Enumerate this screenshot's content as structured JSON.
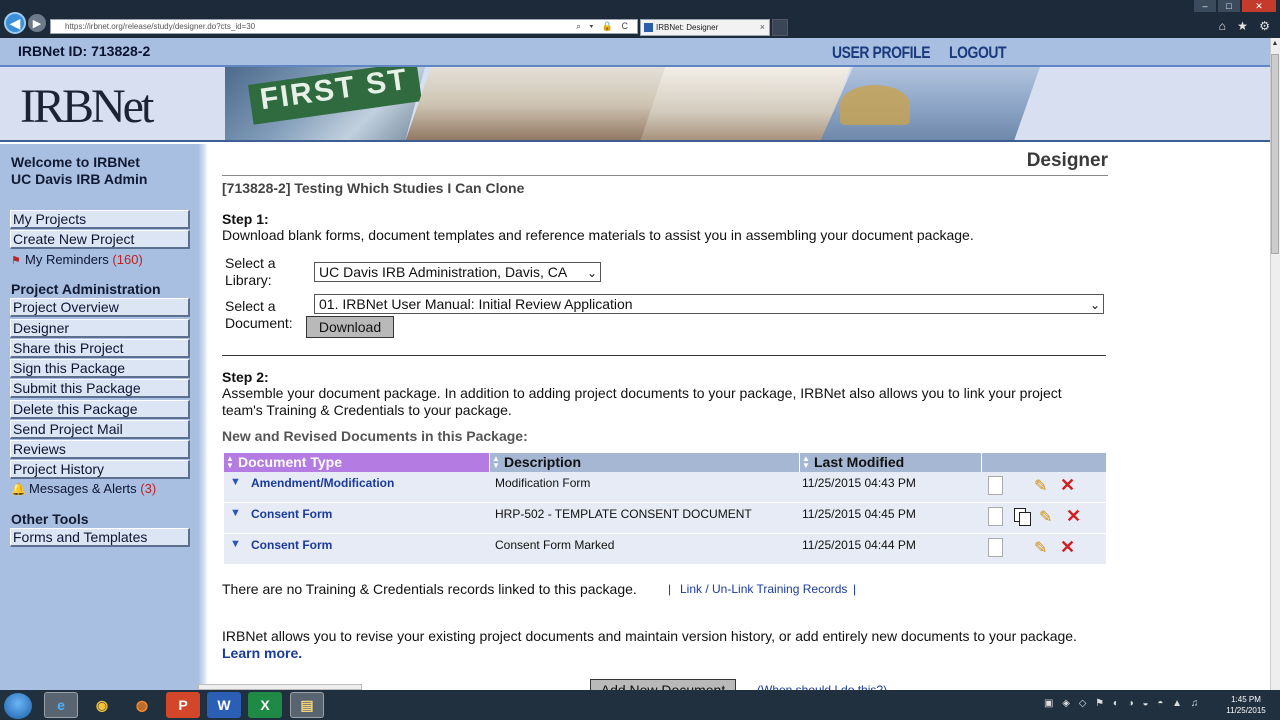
{
  "browser": {
    "url": "https://irbnet.org/release/study/designer.do?cts_id=30",
    "tab_title": "IRBNet: Designer",
    "tab_close": "×",
    "addr_icons": "⌕ ▾ 🔒 C",
    "tool_icons": "⌂ ★ ⚙",
    "win_min": "–",
    "win_max": "□",
    "win_close": "✕"
  },
  "header": {
    "irbnet_id": "IRBNet ID: 713828-2",
    "user_profile": "USER PROFILE",
    "logout": "LOGOUT"
  },
  "banner": {
    "logo_text": "IRBNet",
    "logo_tm": "TM",
    "sign_text": "FIRST ST"
  },
  "sidebar": {
    "welcome_line1": "Welcome to IRBNet",
    "welcome_line2": "UC Davis IRB Admin",
    "top_items": [
      "My Projects",
      "Create New Project"
    ],
    "reminders_label": "My Reminders",
    "reminders_count": "(160)",
    "admin_heading": "Project Administration",
    "admin_items": [
      "Project Overview",
      "Designer",
      "Share this Project",
      "Sign this Package",
      "Submit this Package",
      "Delete this Package",
      "Send Project Mail",
      "Reviews",
      "Project History"
    ],
    "messages_label": "Messages & Alerts",
    "messages_count": "(3)",
    "other_heading": "Other Tools",
    "other_items": [
      "Forms and Templates"
    ]
  },
  "main": {
    "page_title": "Designer",
    "study_title": "[713828-2] Testing Which Studies I Can Clone",
    "step1_heading": "Step 1:",
    "step1_text": "Download blank forms, document templates and reference materials to assist you in assembling your document package.",
    "library_label_1": "Select a",
    "library_label_2": "Library:",
    "library_value": "UC Davis IRB Administration, Davis, CA",
    "document_label_1": "Select a",
    "document_label_2": "Document:",
    "document_value": "01. IRBNet User Manual: Initial Review Application",
    "download_button": "Download",
    "step2_heading": "Step 2:",
    "step2_text": "Assemble your document package. In addition to adding project documents to your package, IRBNet also allows you to link your project team's Training & Credentials to your package.",
    "docs_heading": "New and Revised Documents in this Package:",
    "columns": [
      "Document Type",
      "Description",
      "Last Modified"
    ],
    "documents": [
      {
        "type": "Amendment/Modification",
        "description": "Modification Form",
        "modified": "11/25/2015 04:43 PM"
      },
      {
        "type": "Consent Form",
        "description": "HRP-502 - TEMPLATE CONSENT DOCUMENT",
        "modified": "11/25/2015 04:45 PM"
      },
      {
        "type": "Consent Form",
        "description": "Consent Form Marked",
        "modified": "11/25/2015 04:44 PM"
      }
    ],
    "training_text": "There are no Training & Credentials records linked to this package.",
    "training_pipe": "|",
    "training_link": "Link / Un-Link Training Records",
    "revise_text": "IRBNet allows you to revise your existing project documents and maintain version history, or add entirely new documents to your package.",
    "learn_more": "Learn more.",
    "add_document_button": "Add New Document",
    "when_link": "(When should I do this?)"
  },
  "taskbar": {
    "apps": [
      "e",
      "◉",
      "◍",
      "P",
      "W",
      "X",
      "▤"
    ],
    "tray_icons": "▣ ◈ ◇ ⚑ ◐ ◑ ◒ ◓ ▲ ♫",
    "time": "1:45 PM",
    "date": "11/25/2015"
  },
  "colors": {
    "sidebar_bg": "#a9bfe2",
    "active_header": "#b47be3",
    "link": "#1b3b9b",
    "alert_count": "#c02020"
  }
}
